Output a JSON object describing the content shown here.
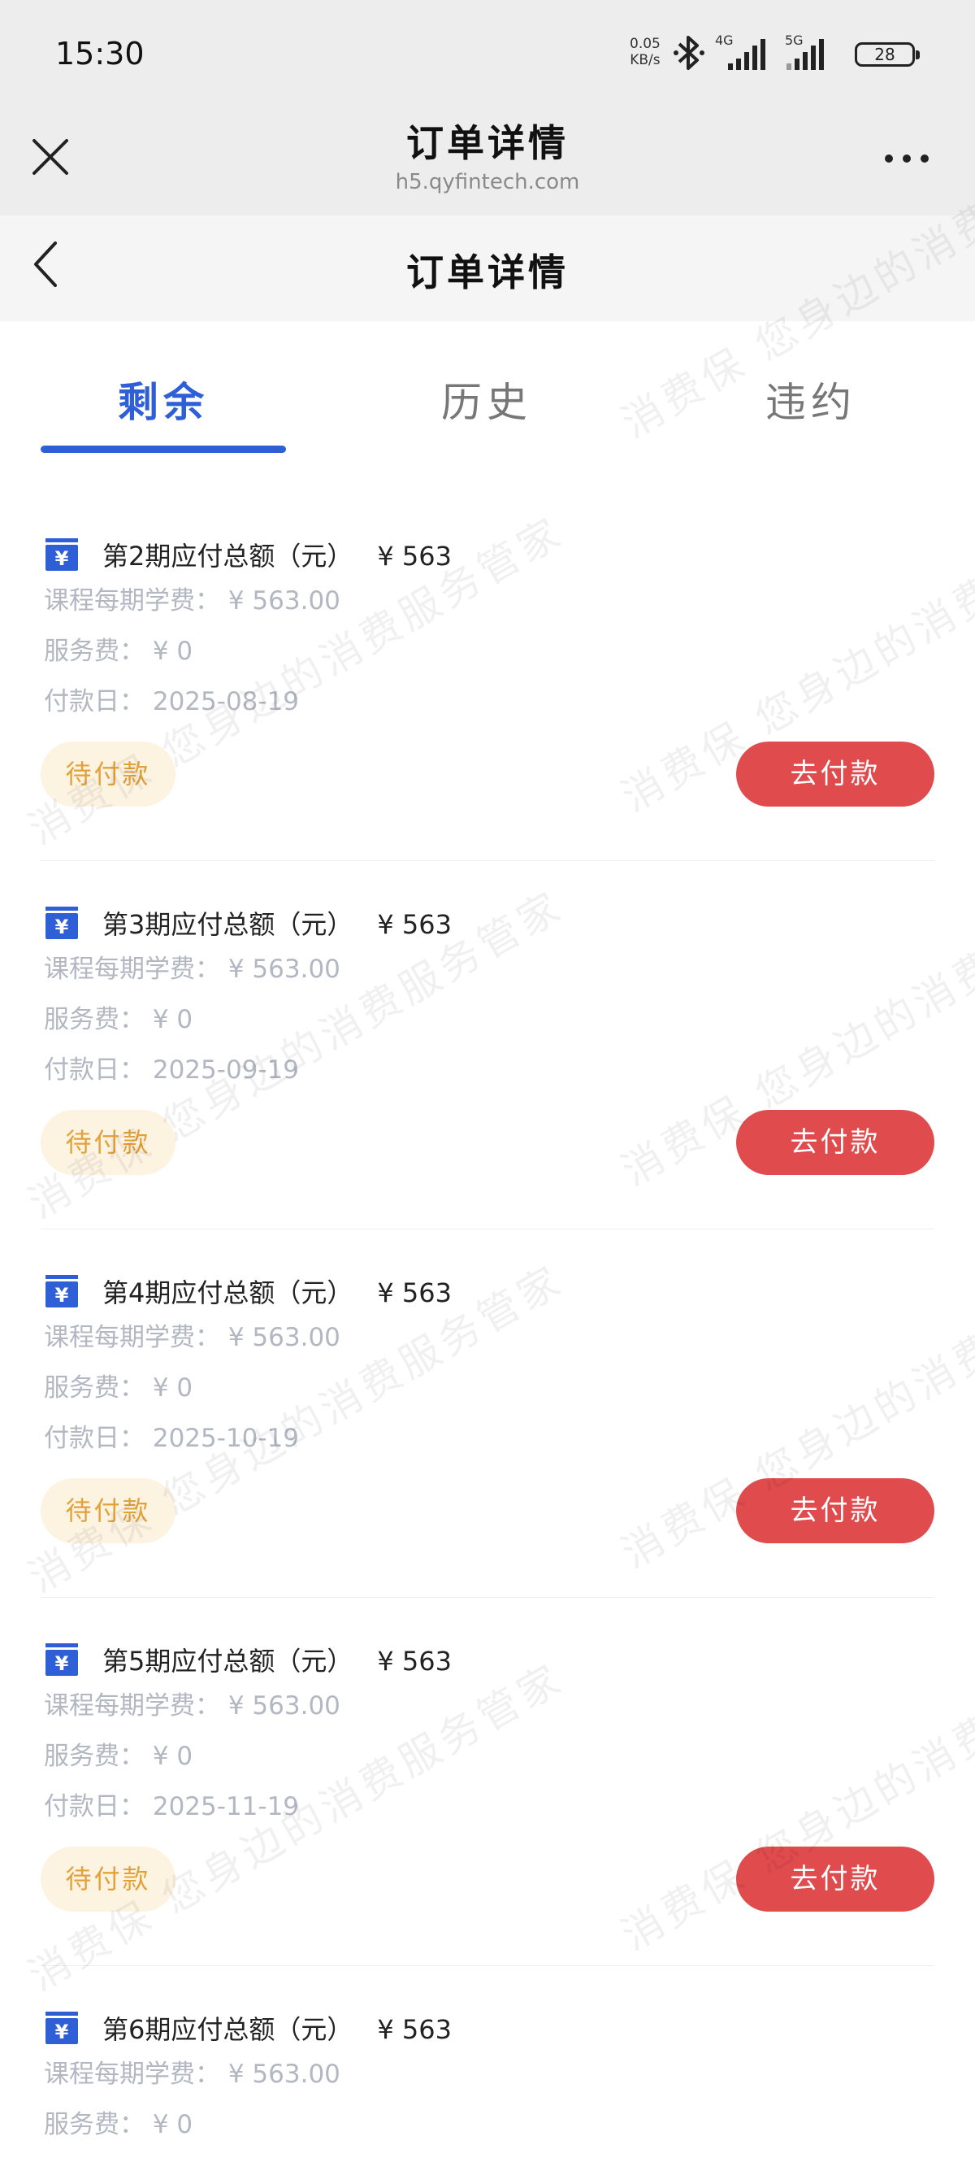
{
  "status_bar": {
    "time": "15:30",
    "net_speed": "0.05",
    "net_unit": "KB/s",
    "signal1": "4G",
    "signal2": "5G",
    "battery": "28"
  },
  "titlebar": {
    "title": "订单详情",
    "url": "h5.qyfintech.com"
  },
  "navbar": {
    "title": "订单详情"
  },
  "tabs": [
    {
      "label": "剩余",
      "active": true
    },
    {
      "label": "历史",
      "active": false
    },
    {
      "label": "违约",
      "active": false
    }
  ],
  "labels": {
    "course_fee": "课程每期学费：",
    "service_fee": "服务费：",
    "pay_date": "付款日：",
    "status_pending": "待付款",
    "pay_button": "去付款"
  },
  "installments": [
    {
      "title": "第2期应付总额（元）",
      "amount": "¥ 563",
      "course_fee": "¥ 563.00",
      "service_fee": "¥ 0",
      "pay_date": "2025-08-19"
    },
    {
      "title": "第3期应付总额（元）",
      "amount": "¥ 563",
      "course_fee": "¥ 563.00",
      "service_fee": "¥ 0",
      "pay_date": "2025-09-19"
    },
    {
      "title": "第4期应付总额（元）",
      "amount": "¥ 563",
      "course_fee": "¥ 563.00",
      "service_fee": "¥ 0",
      "pay_date": "2025-10-19"
    },
    {
      "title": "第5期应付总额（元）",
      "amount": "¥ 563",
      "course_fee": "¥ 563.00",
      "service_fee": "¥ 0",
      "pay_date": "2025-11-19"
    },
    {
      "title": "第6期应付总额（元）",
      "amount": "¥ 563",
      "course_fee": "¥ 563.00",
      "service_fee": "¥ 0",
      "pay_date": ""
    }
  ],
  "watermark_text": "消费保 您身边的消费服务管家",
  "colors": {
    "accent_blue": "#2f5fd6",
    "pay_red": "#e04b4d",
    "pending_orange": "#e2a23b",
    "pending_bg": "#fdf3e1"
  }
}
